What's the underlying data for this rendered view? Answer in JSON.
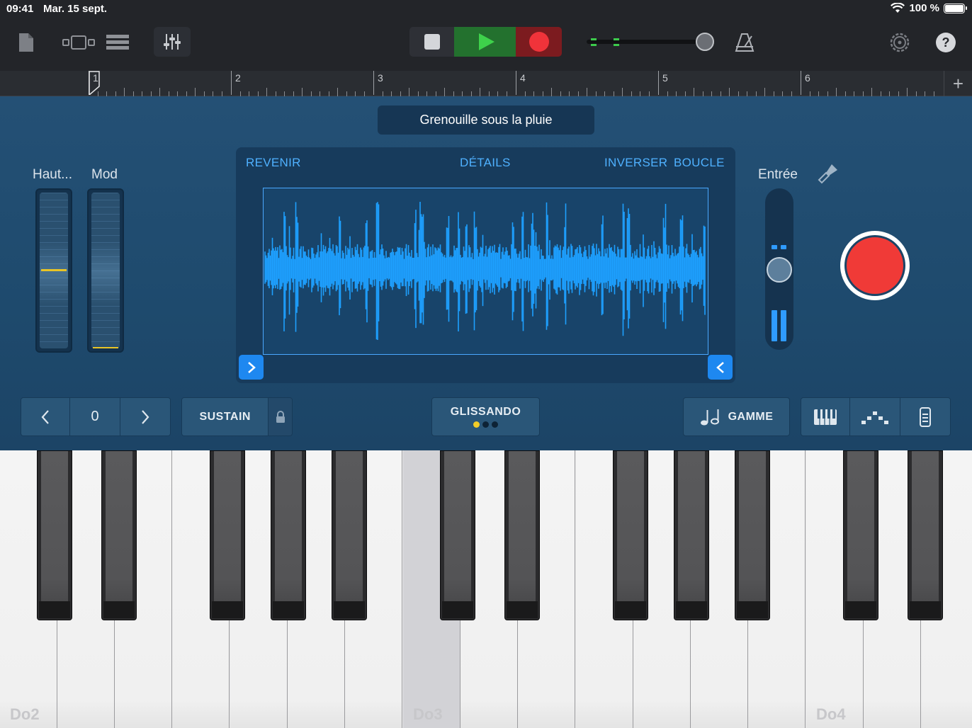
{
  "status": {
    "time": "09:41",
    "date": "Mar. 15 sept.",
    "battery": "100 %"
  },
  "toolbar": {
    "buttons": [
      "my-songs",
      "tracks-view",
      "browser-view",
      "mixer"
    ],
    "transport": [
      "stop",
      "play",
      "record"
    ],
    "volume_level": 0.92,
    "right": [
      "metronome",
      "settings",
      "help"
    ]
  },
  "ruler": {
    "bars": [
      "1",
      "2",
      "3",
      "4",
      "5",
      "6"
    ],
    "plus": "+"
  },
  "preset": {
    "name": "Grenouille sous la pluie"
  },
  "wheels": {
    "pitch_label": "Haut...",
    "mod_label": "Mod"
  },
  "sampler": {
    "tabs": {
      "revert": "REVENIR",
      "details": "DÉTAILS",
      "reverse": "INVERSER",
      "loop": "BOUCLE"
    }
  },
  "input": {
    "label": "Entrée"
  },
  "controls": {
    "octave_value": "0",
    "sustain": "SUSTAIN",
    "glissando": "GLISSANDO",
    "scale": "GAMME"
  },
  "keyboard": {
    "labels": [
      "Do2",
      "Do3",
      "Do4"
    ],
    "pressed_key": "Do3"
  },
  "colors": {
    "accent": "#2f9bff",
    "record": "#f0333a",
    "play": "#3ed24b",
    "panel": "#1e4a6d"
  }
}
